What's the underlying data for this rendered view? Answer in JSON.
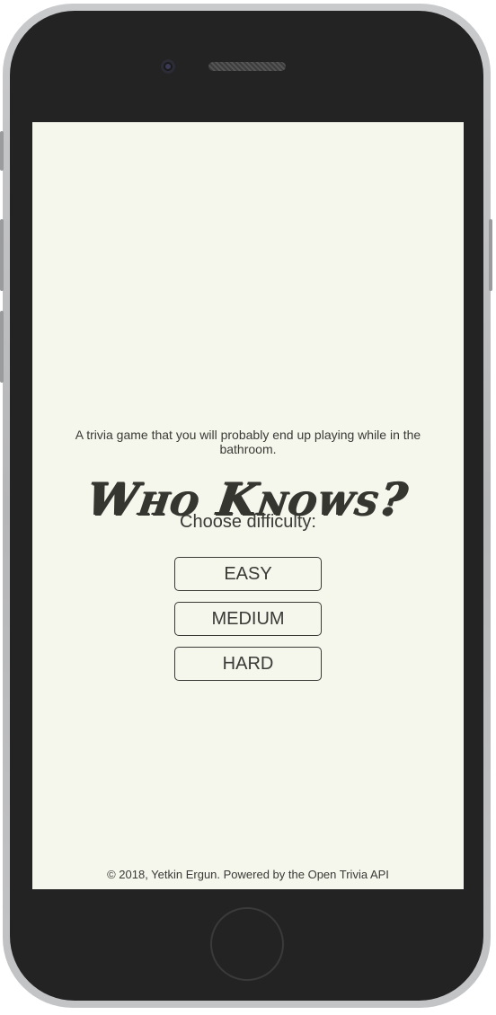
{
  "app": {
    "title": "Who Knows?",
    "tagline": "A trivia game that you will probably end up playing while in the bathroom."
  },
  "difficulty": {
    "prompt": "Choose difficulty:",
    "options": [
      {
        "label": "EASY"
      },
      {
        "label": "MEDIUM"
      },
      {
        "label": "HARD"
      }
    ]
  },
  "footer": {
    "text": "© 2018, Yetkin Ergun. Powered by the Open Trivia API"
  },
  "colors": {
    "background": "#f5f6ec",
    "text": "#363631",
    "device_frame": "#232323"
  }
}
